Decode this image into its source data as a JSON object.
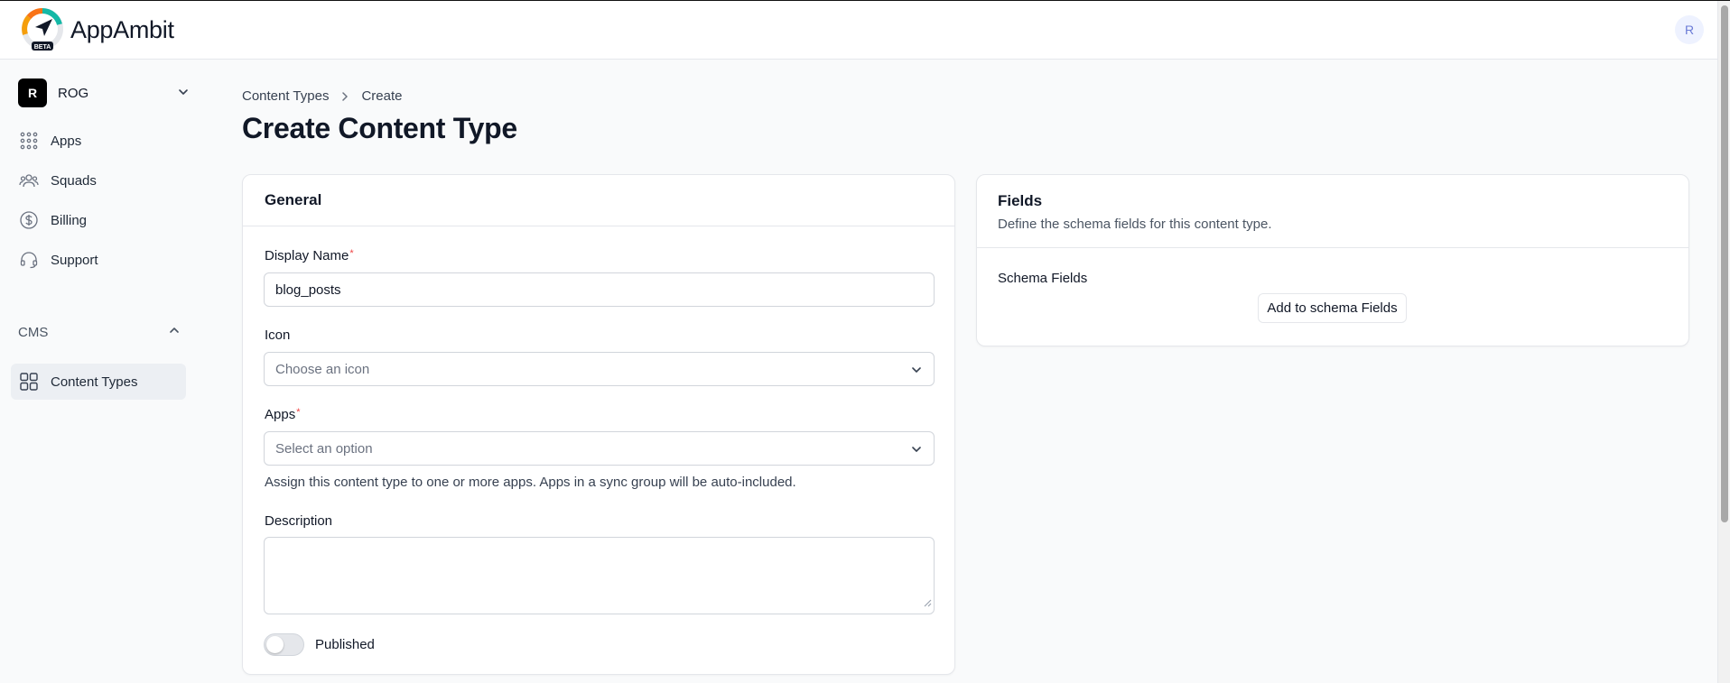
{
  "app": {
    "name": "AppAmbit",
    "badge": "BETA",
    "user_initial": "R"
  },
  "sidebar": {
    "team": {
      "initial": "R",
      "name": "ROG"
    },
    "items": [
      {
        "label": "Apps",
        "icon": "grid-dots-icon"
      },
      {
        "label": "Squads",
        "icon": "users-icon"
      },
      {
        "label": "Billing",
        "icon": "dollar-circle-icon"
      },
      {
        "label": "Support",
        "icon": "headset-icon"
      }
    ],
    "section": {
      "label": "CMS"
    },
    "section_items": [
      {
        "label": "Content Types",
        "icon": "squares-icon",
        "active": true
      }
    ]
  },
  "breadcrumb": {
    "parent": "Content Types",
    "current": "Create"
  },
  "page": {
    "title": "Create Content Type"
  },
  "general": {
    "title": "General",
    "display_name": {
      "label": "Display Name",
      "value": "blog_posts",
      "required": "*"
    },
    "icon": {
      "label": "Icon",
      "placeholder": "Choose an icon"
    },
    "apps": {
      "label": "Apps",
      "required": "*",
      "placeholder": "Select an option",
      "helper": "Assign this content type to one or more apps. Apps in a sync group will be auto-included."
    },
    "description": {
      "label": "Description",
      "value": ""
    },
    "published": {
      "label": "Published",
      "on": false
    }
  },
  "fields": {
    "title": "Fields",
    "description": "Define the schema fields for this content type.",
    "schema_label": "Schema Fields",
    "add_button": "Add to schema Fields"
  },
  "colors": {
    "accent_orange": "#f59e0b",
    "accent_teal": "#14b8a6",
    "required": "#ef4444"
  }
}
